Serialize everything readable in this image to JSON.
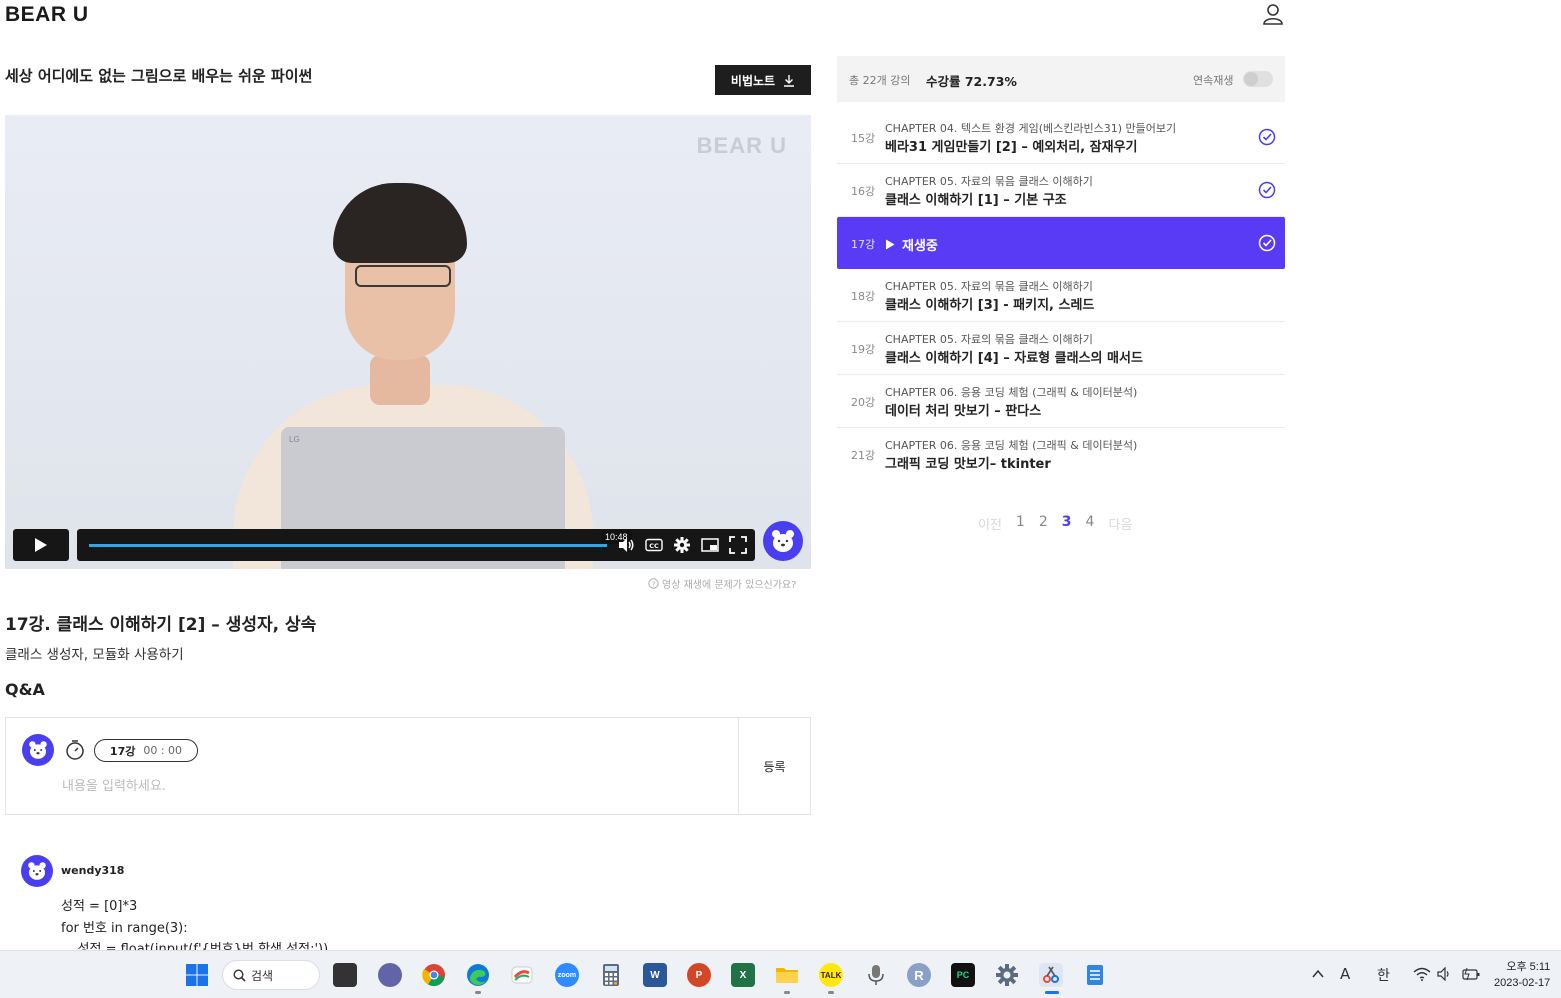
{
  "header": {
    "logo": "BEAR U"
  },
  "course": {
    "title": "세상 어디에도 없는 그림으로 배우는 쉬운 파이썬",
    "note_button": "비법노트"
  },
  "video": {
    "watermark": "BEAR U",
    "laptop_brand": "LG",
    "progress": 1.0,
    "hover_time": "10:48"
  },
  "help": {
    "text": "영상 재생에 문제가 있으신가요?"
  },
  "lecture": {
    "title": "17강. 클래스 이해하기 [2] – 생성자, 상속",
    "subtitle": "클래스 생성자, 모듈화 사용하기"
  },
  "qa": {
    "heading": "Q&A",
    "pill_lecture": "17강",
    "pill_time": "00 : 00",
    "placeholder": "내용을 입력하세요.",
    "register": "등록"
  },
  "comment": {
    "user": "wendy318",
    "lines": [
      "성적 = [0]*3",
      "for 번호 in range(3):",
      "    성적 = float(input(f'{번호}번 학생 성적:'))"
    ]
  },
  "sidebar": {
    "total": "총 22개 강의",
    "progress": "수강률 72.73%",
    "autoplay_label": "연속재생",
    "autoplay_on": false,
    "items": [
      {
        "num": "15강",
        "chapter": "CHAPTER 04. 텍스트 환경 게임(베스킨라빈스31) 만들어보기",
        "name": "베라31 게임만들기 [2] – 예외처리, 잠재우기",
        "done": true
      },
      {
        "num": "16강",
        "chapter": "CHAPTER 05. 자료의 묶음 클래스 이해하기",
        "name": "클래스 이해하기 [1] – 기본 구조",
        "done": true
      },
      {
        "num": "17강",
        "playing_label": "재생중",
        "done": true
      },
      {
        "num": "18강",
        "chapter": "CHAPTER 05. 자료의 묶음 클래스 이해하기",
        "name": "클래스 이해하기 [3] - 패키지, 스레드",
        "done": false
      },
      {
        "num": "19강",
        "chapter": "CHAPTER 05. 자료의 묶음 클래스 이해하기",
        "name": "클래스 이해하기 [4] – 자료형 클래스의 매서드",
        "done": false
      },
      {
        "num": "20강",
        "chapter": "CHAPTER 06. 응용 코딩 체험 (그래픽 & 데이터분석)",
        "name": "데이터 처리 맛보기 – 판다스",
        "done": false
      },
      {
        "num": "21강",
        "chapter": "CHAPTER 06. 응용 코딩 체험 (그래픽 & 데이터분석)",
        "name": "그래픽 코딩 맛보기– tkinter",
        "done": false
      }
    ]
  },
  "pager": {
    "prev": "이전",
    "pages": [
      "1",
      "2",
      "3",
      "4"
    ],
    "current": "3",
    "next": "다음"
  },
  "taskbar": {
    "search": "검색",
    "ime_a": "A",
    "ime_han": "한",
    "time": "오후 5:11",
    "date": "2023-02-17",
    "colors": {
      "accent": "#5a3bf5",
      "progress": "#2aa8e8"
    }
  }
}
